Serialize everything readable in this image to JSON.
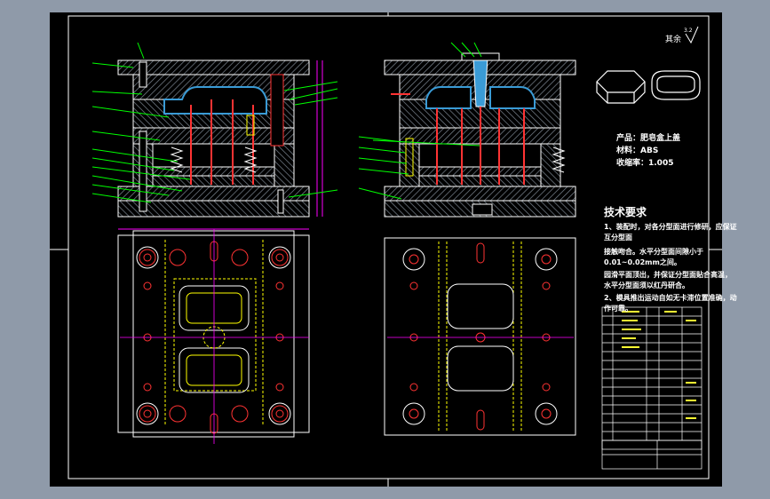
{
  "title_block": {
    "product": "产品：肥皂盒上盖",
    "material": "材料：ABS",
    "shrinkage": "收缩率：1.005"
  },
  "surface_finish_note": "其余",
  "tech_requirements": {
    "heading": "技术要求",
    "lines": [
      "1、装配时，对各分型面进行修研，应保证",
      "互分型面",
      "接触吻合。水平分型面间隙小于",
      "0.01~0.02mm之间。",
      "园滑平面顶出，并保证分型面贴合高温，",
      "水平分型面须以红丹研合。",
      "2、模具推出运动自如无卡滞位置准确，动",
      "作可靠。"
    ]
  },
  "colors": {
    "sheet_bg": "#000000",
    "border": "#ffffff",
    "plate_outline": "#ffffff",
    "hatch": "#9aa3ae",
    "leader": "#00ff00",
    "dimension": "#ff00ff",
    "hidden_line": "#ffff00",
    "ejector_pins": "#ff3333",
    "cavity": "#3a9bd6"
  },
  "icons": [
    "surface-roughness-icon",
    "soap-box-3d-icon"
  ]
}
